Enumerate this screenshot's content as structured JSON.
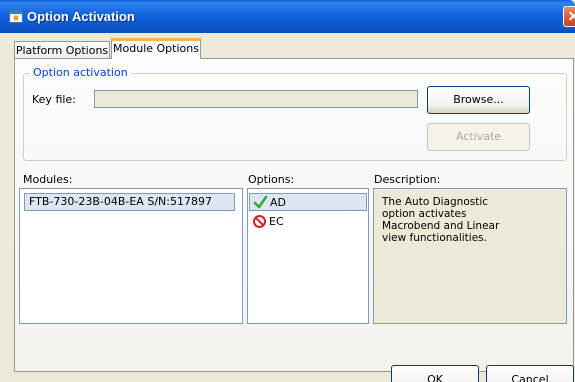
{
  "window": {
    "title": "Option Activation"
  },
  "tabs": [
    {
      "label": "Platform Options",
      "active": false
    },
    {
      "label": "Module Options",
      "active": true
    }
  ],
  "activation": {
    "group_label": "Option activation",
    "key_file_label": "Key file:",
    "key_file_value": "",
    "browse_label": "Browse...",
    "activate_label": "Activate",
    "activate_enabled": false
  },
  "modules": {
    "header": "Modules:",
    "items": [
      {
        "label": "FTB-730-23B-04B-EA S/N:517897",
        "selected": true
      }
    ]
  },
  "options": {
    "header": "Options:",
    "items": [
      {
        "label": "AD",
        "status": "check-icon",
        "selected": true
      },
      {
        "label": "EC",
        "status": "prohibited-icon",
        "selected": false
      }
    ]
  },
  "description": {
    "header": "Description:",
    "text": "The Auto Diagnostic option activates Macrobend and Linear view functionalities."
  },
  "footer": {
    "ok_label": "OK",
    "cancel_label": "Cancel"
  },
  "colors": {
    "titlebar": "#0a5fd6",
    "selection": "#dde6f2",
    "group_label": "#0046d5",
    "tab_accent": "#f6b64a"
  }
}
